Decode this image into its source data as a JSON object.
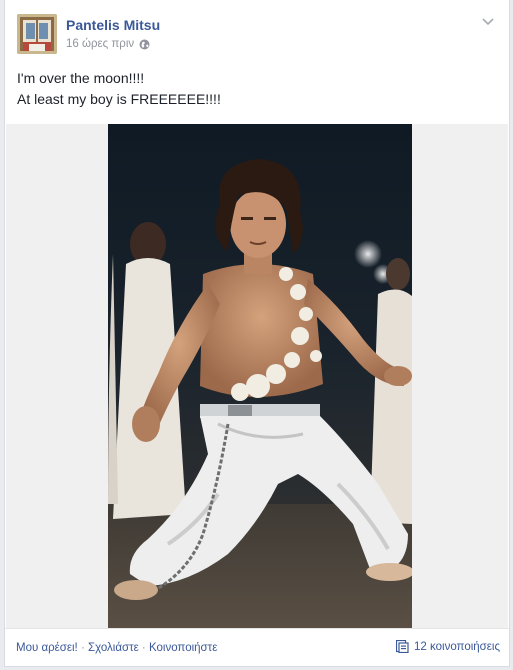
{
  "post": {
    "author": "Pantelis Mitsu",
    "timestamp": "16 ώρες πριν",
    "audience_icon": "globe-icon",
    "menu_icon": "chevron-down-icon",
    "message_lines": [
      "I'm over the moon!!!!",
      "At least my boy is FREEEEEE!!!!"
    ]
  },
  "actions": {
    "like": "Μου αρέσει!",
    "comment": "Σχολιάστε",
    "share": "Κοινοποιήστε",
    "separator": " · "
  },
  "shares": {
    "icon": "share-icon",
    "label": "12 κοινοποιήσεις"
  },
  "colors": {
    "link": "#3b5998",
    "meta": "#90949c",
    "text": "#1d2129"
  }
}
